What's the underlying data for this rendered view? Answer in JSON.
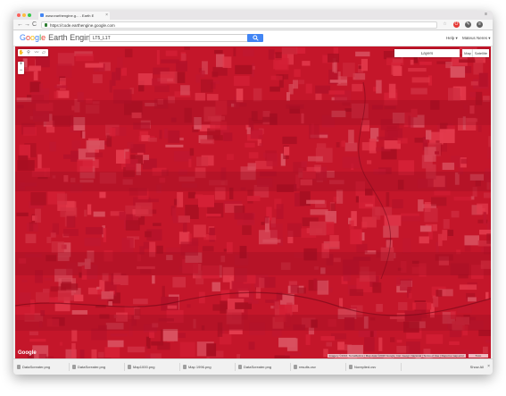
{
  "browser": {
    "tab_title": "www.earthengine.g... - Earth E",
    "tab_close": "×",
    "window_user": "≡",
    "url": "https://code.earthengine.google.com",
    "nav": {
      "back": "←",
      "forward": "→",
      "reload": "C"
    },
    "extensions": [
      {
        "icon": "star-icon",
        "glyph": "☆",
        "color": "#999999"
      },
      {
        "icon": "opera-icon",
        "glyph": "O",
        "color": "#e53935"
      },
      {
        "icon": "extension-icon",
        "glyph": "✎",
        "color": "#616161"
      },
      {
        "icon": "menu-icon",
        "glyph": "≡",
        "color": "#616161"
      }
    ]
  },
  "app": {
    "logo_letters": [
      "G",
      "o",
      "o",
      "g",
      "l",
      "e"
    ],
    "product": "Earth Engine",
    "search_value": "LT5_L1T",
    "help_label": "Help ▾",
    "user_label": "Mateus Neres ▾"
  },
  "map": {
    "tools": [
      "✋",
      "⚲",
      "〰",
      "▱"
    ],
    "zoom_in": "+",
    "zoom_out": "−",
    "layers_label": "Layers",
    "map_label": "Map",
    "satellite_label": "Satellite",
    "google_watermark": "Google",
    "attribution": "Imagery ©2016, TerraMetrics | Map data ©2016 Google, Inst. Geogr. Nacional | Terms of Use | Report a map error",
    "scale_label": "5 km"
  },
  "downloads": {
    "items": [
      "DataScreater.png",
      "DataScreater.png",
      "Map1000.png",
      "Map 1996.png",
      "DataScreater.png",
      "results.csv",
      "Noreplied.csv"
    ],
    "show_all": "Show All",
    "close": "×"
  },
  "colors": {
    "map_base": "#c4162a",
    "search_button": "#4285f4"
  }
}
